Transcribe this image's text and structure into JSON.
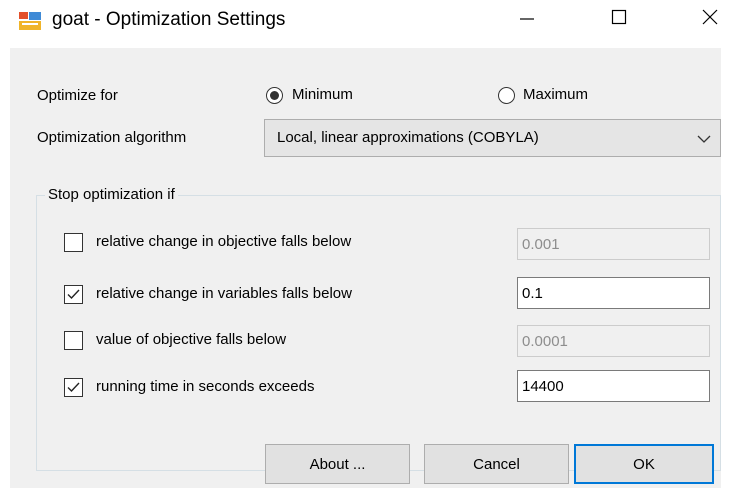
{
  "window": {
    "title": "goat - Optimization Settings"
  },
  "optimize_for": {
    "label": "Optimize for",
    "options": [
      {
        "label": "Minimum",
        "selected": true
      },
      {
        "label": "Maximum",
        "selected": false
      }
    ]
  },
  "algorithm": {
    "label": "Optimization algorithm",
    "selected": "Local, linear approximations (COBYLA)"
  },
  "stop": {
    "title": "Stop optimization if",
    "criteria": [
      {
        "label": "relative change in objective falls below",
        "checked": false,
        "value": "0.001",
        "enabled": false
      },
      {
        "label": "relative change in variables falls below",
        "checked": true,
        "value": "0.1",
        "enabled": true
      },
      {
        "label": "value of objective falls below",
        "checked": false,
        "value": "0.0001",
        "enabled": false
      },
      {
        "label": "running time in seconds exceeds",
        "checked": true,
        "value": "14400",
        "enabled": true
      }
    ]
  },
  "buttons": {
    "about": "About ...",
    "cancel": "Cancel",
    "ok": "OK"
  },
  "colors": {
    "client_bg": "#f0f0f0",
    "button_bg": "#e1e1e1",
    "default_button_border": "#0078d7",
    "disabled_text": "#8d8d8d"
  },
  "icons": {
    "app": "app-settings-icon",
    "minimize": "minimize-icon",
    "maximize": "maximize-icon",
    "close": "close-icon",
    "dropdown": "chevron-down-icon",
    "check": "checkmark-icon"
  }
}
